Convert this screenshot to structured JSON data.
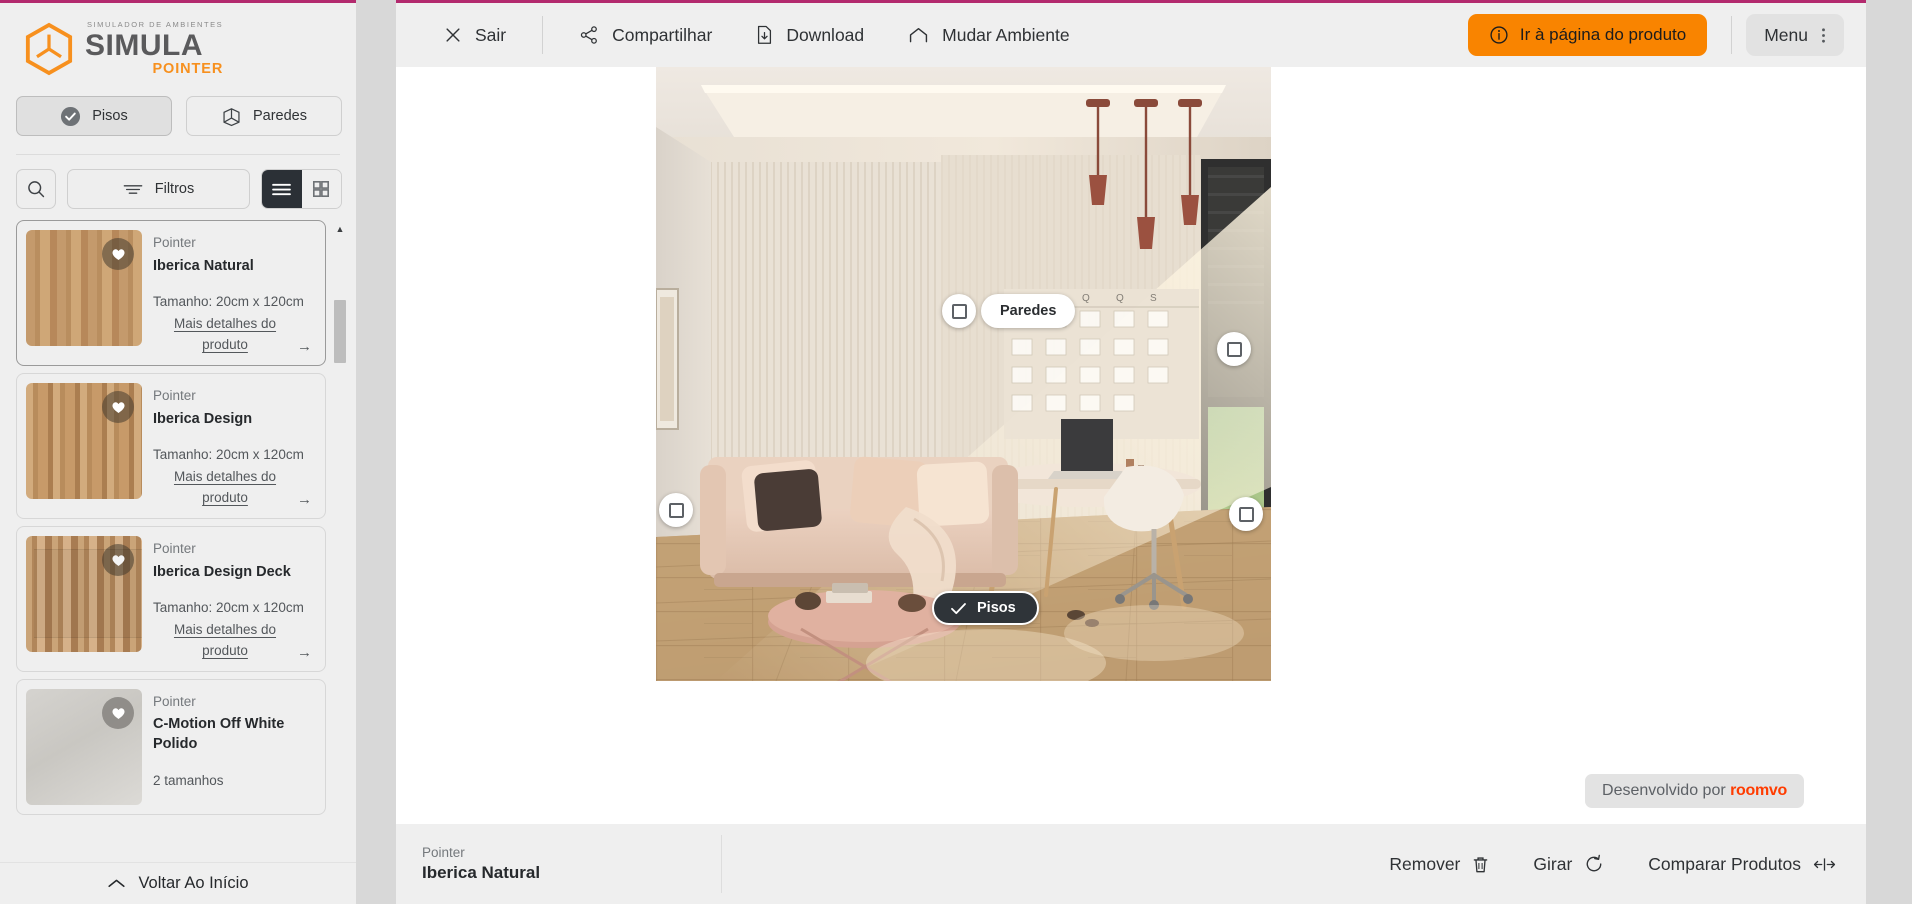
{
  "brand": {
    "tagline": "SIMULADOR DE AMBIENTES",
    "name": "SIMULA",
    "sub": "POINTER",
    "orange": "#f7901e"
  },
  "sidebar": {
    "segments": [
      {
        "label": "Pisos",
        "icon": "check-circle-icon",
        "active": true
      },
      {
        "label": "Paredes",
        "icon": "wall-corner-icon",
        "active": false
      }
    ],
    "tools": {
      "search_icon": "search-icon",
      "filter_label": "Filtros",
      "filter_icon": "filter-icon",
      "view_list_icon": "list-view-icon",
      "view_grid_icon": "grid-view-icon",
      "view_active": "list"
    },
    "products": [
      {
        "brand": "Pointer",
        "name": "Iberica Natural",
        "size": "Tamanho: 20cm x 120cm",
        "more": "Mais detalhes do produto",
        "selected": true,
        "swatch": "w1",
        "favorite_icon": "heart-icon"
      },
      {
        "brand": "Pointer",
        "name": "Iberica Design",
        "size": "Tamanho: 20cm x 120cm",
        "more": "Mais detalhes do produto",
        "selected": false,
        "swatch": "w2",
        "favorite_icon": "heart-icon"
      },
      {
        "brand": "Pointer",
        "name": "Iberica Design Deck",
        "size": "Tamanho: 20cm x 120cm",
        "more": "Mais detalhes do produto",
        "selected": false,
        "swatch": "w3",
        "favorite_icon": "heart-icon"
      },
      {
        "brand": "Pointer",
        "name": "C-Motion Off White Polido",
        "size": "2 tamanhos",
        "more": "",
        "selected": false,
        "swatch": "g1",
        "favorite_icon": "heart-icon"
      }
    ],
    "back_to_top": "Voltar Ao Início"
  },
  "toolbar": {
    "exit": {
      "label": "Sair",
      "icon": "close-icon"
    },
    "share": {
      "label": "Compartilhar",
      "icon": "share-icon"
    },
    "download": {
      "label": "Download",
      "icon": "download-file-icon"
    },
    "change_room": {
      "label": "Mudar Ambiente",
      "icon": "home-icon"
    },
    "cta": {
      "label": "Ir à página do produto",
      "icon": "info-icon",
      "color": "#f98400"
    },
    "menu": {
      "label": "Menu",
      "icon": "kebab-menu-icon"
    }
  },
  "viewer": {
    "pill_walls": {
      "label": "Paredes",
      "icon": "square-icon"
    },
    "pill_floors": {
      "label": "Pisos",
      "icon": "check-icon"
    },
    "credit_prefix": "Desenvolvido por",
    "credit_brand": "roomvo",
    "credit_color": "#ff3c00"
  },
  "bottombar": {
    "product_brand": "Pointer",
    "product_name": "Iberica Natural",
    "actions": [
      {
        "label": "Remover",
        "icon": "trash-icon"
      },
      {
        "label": "Girar",
        "icon": "rotate-icon"
      },
      {
        "label": "Comparar Produtos",
        "icon": "compare-icon"
      }
    ]
  }
}
